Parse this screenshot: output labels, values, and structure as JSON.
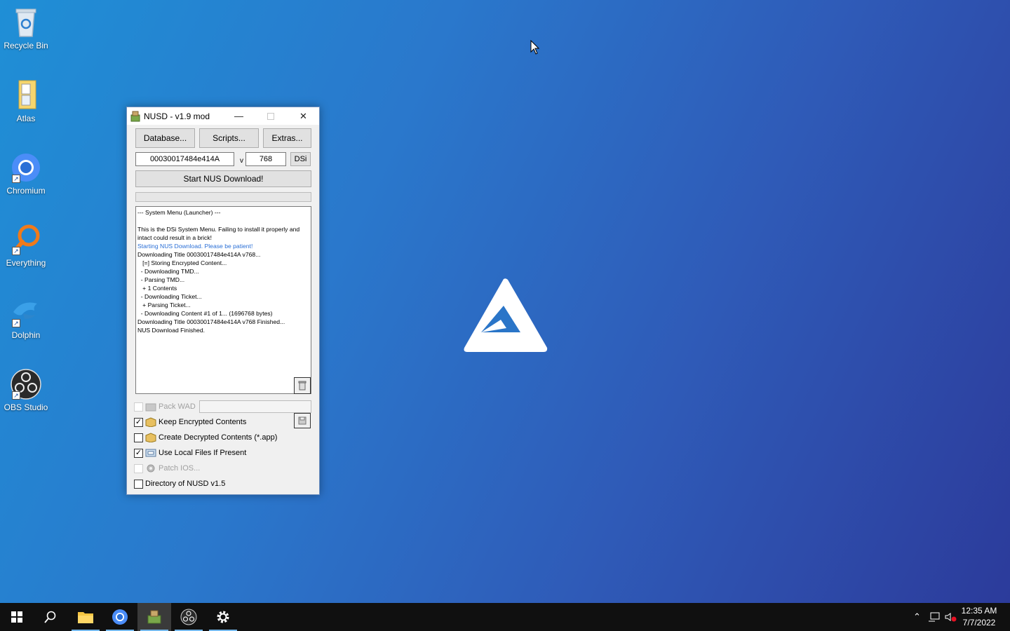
{
  "desktop": {
    "icons": [
      {
        "label": "Recycle Bin"
      },
      {
        "label": "Atlas"
      },
      {
        "label": "Chromium"
      },
      {
        "label": "Everything"
      },
      {
        "label": "Dolphin"
      },
      {
        "label": "OBS Studio"
      }
    ]
  },
  "window": {
    "title": "NUSD - v1.9 mod",
    "minimize_label": "—",
    "close_label": "✕",
    "buttons": {
      "database": "Database...",
      "scripts": "Scripts...",
      "extras": "Extras..."
    },
    "title_id": "00030017484e414A",
    "version_prefix": "v",
    "version": "768",
    "dsi_label": "DSi",
    "start_label": "Start NUS Download!",
    "progress": 0,
    "log": [
      {
        "text": "--- System Menu (Launcher) ---",
        "style": "normal"
      },
      {
        "text": "",
        "style": "normal"
      },
      {
        "text": "This is the DSi System Menu. Failing to install it properly and",
        "style": "normal"
      },
      {
        "text": "intact could result in a brick!",
        "style": "normal"
      },
      {
        "text": "Starting NUS Download. Please be patient!",
        "style": "blue"
      },
      {
        "text": "Downloading Title 00030017484e414A v768...",
        "style": "normal"
      },
      {
        "text": "   [=] Storing Encrypted Content...",
        "style": "normal"
      },
      {
        "text": "  - Downloading TMD...",
        "style": "normal"
      },
      {
        "text": "  - Parsing TMD...",
        "style": "normal"
      },
      {
        "text": "   + 1 Contents",
        "style": "normal"
      },
      {
        "text": "  - Downloading Ticket...",
        "style": "normal"
      },
      {
        "text": "   + Parsing Ticket...",
        "style": "normal"
      },
      {
        "text": "  - Downloading Content #1 of 1... (1696768 bytes)",
        "style": "normal"
      },
      {
        "text": "Downloading Title 00030017484e414A v768 Finished...",
        "style": "normal"
      },
      {
        "text": "NUS Download Finished.",
        "style": "normal"
      }
    ],
    "options": {
      "pack_wad": "Pack WAD",
      "keep_encrypted": "Keep Encrypted Contents",
      "create_decrypted": "Create Decrypted Contents (*.app)",
      "use_local": "Use Local Files If Present",
      "patch_ios": "Patch IOS...",
      "directory": "Directory of NUSD v1.5"
    },
    "checked": {
      "pack_wad": false,
      "keep_encrypted": true,
      "create_decrypted": false,
      "use_local": true,
      "patch_ios": false,
      "directory": false
    }
  },
  "taskbar": {
    "time": "12:35 AM",
    "date": "7/7/2022"
  },
  "colors": {
    "taskbar": "#101010",
    "accent": "#76b9ed",
    "log_blue": "#2a6fd6"
  }
}
